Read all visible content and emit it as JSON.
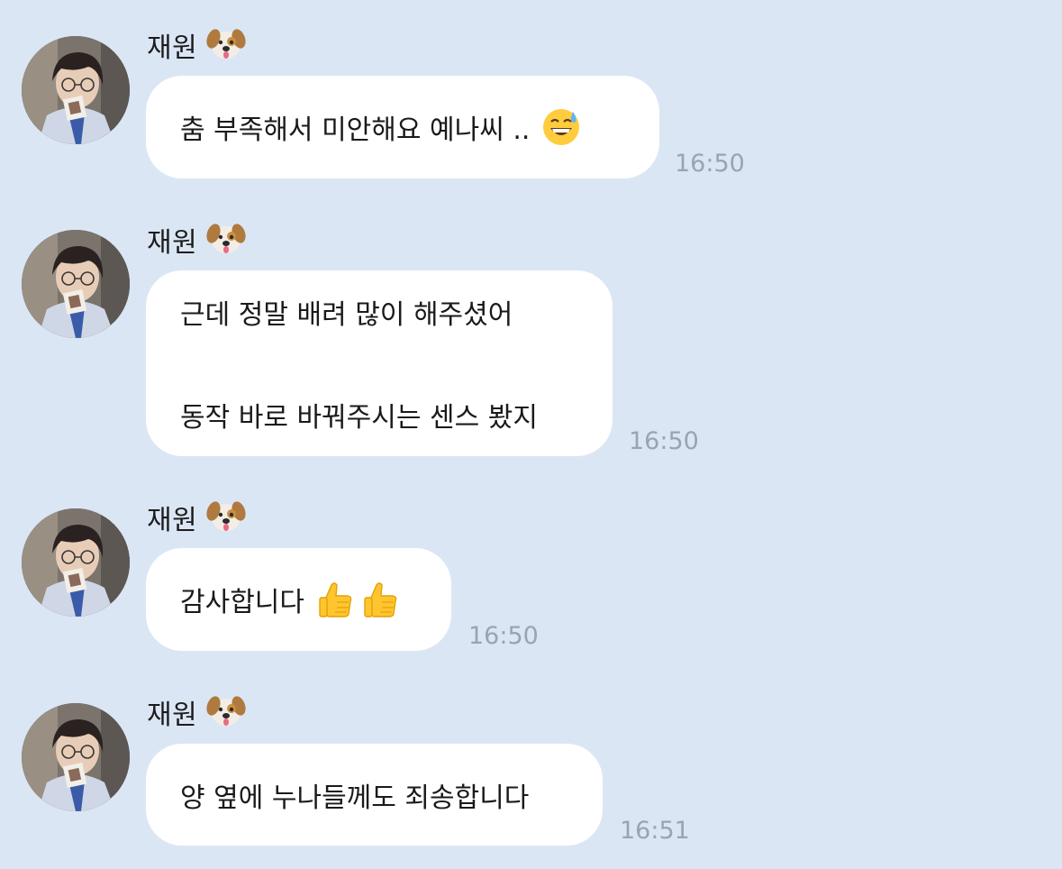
{
  "messages": [
    {
      "sender": "재원",
      "sender_icon": "dog-face-icon",
      "lines": [
        "춤 부족해서 미안해요 예나씨 .."
      ],
      "trailing_emoji": "grinning-sweat-icon",
      "time": "16:50"
    },
    {
      "sender": "재원",
      "sender_icon": "dog-face-icon",
      "lines": [
        "근데 정말 배려 많이 해주셨어",
        "동작 바로 바꿔주시는 센스 봤지"
      ],
      "time": "16:50"
    },
    {
      "sender": "재원",
      "sender_icon": "dog-face-icon",
      "lines": [
        "감사합니다"
      ],
      "trailing_emoji": "thumbs-up-icon x2",
      "time": "16:50"
    },
    {
      "sender": "재원",
      "sender_icon": "dog-face-icon",
      "lines": [
        "양 옆에 누나들께도 죄송합니다"
      ],
      "time": "16:51"
    }
  ],
  "colors": {
    "background": "#dbe6f5",
    "bubble": "#ffffff",
    "text": "#1a1a1a",
    "timestamp": "#9aa4b0"
  }
}
